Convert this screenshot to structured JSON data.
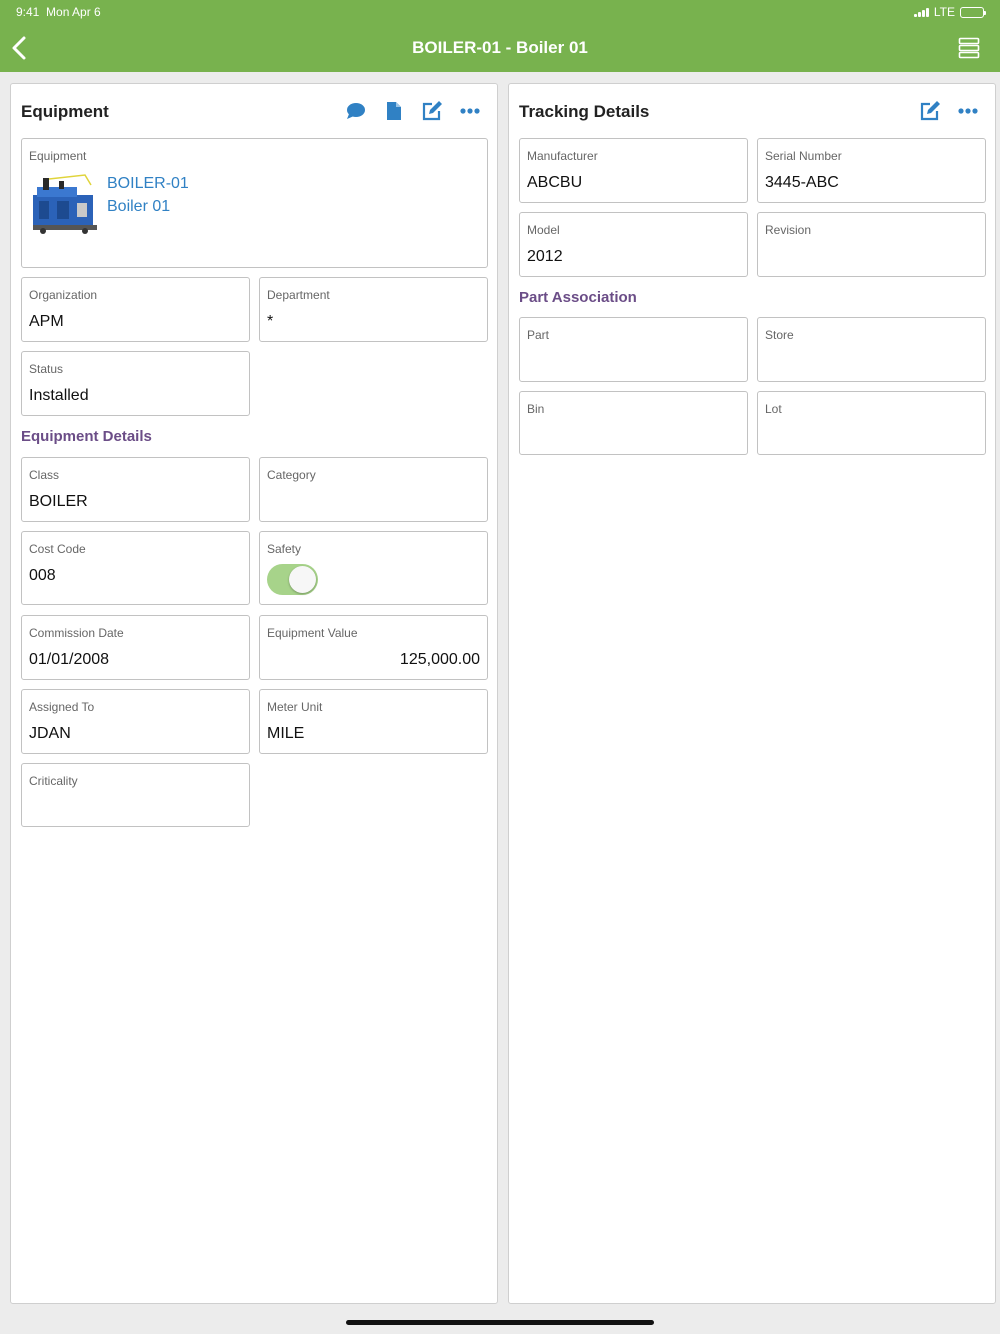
{
  "status_bar": {
    "time": "9:41",
    "date": "Mon Apr 6",
    "network": "LTE"
  },
  "header": {
    "title": "BOILER-01 - Boiler 01",
    "icons": [
      "back-chevron-icon",
      "list-view-icon"
    ]
  },
  "colors": {
    "brand": "#78b24e",
    "link": "#3081c4",
    "section": "#6b4d87",
    "toggle_on": "#a7d38a"
  },
  "equipment_panel": {
    "title": "Equipment",
    "actions": [
      "comment-icon",
      "document-icon",
      "edit-icon",
      "more-icon"
    ],
    "equipment": {
      "label": "Equipment",
      "code": "BOILER-01",
      "description": "Boiler 01",
      "image": "boiler-photo"
    },
    "organization": {
      "label": "Organization",
      "value": "APM"
    },
    "department": {
      "label": "Department",
      "value": "*"
    },
    "status": {
      "label": "Status",
      "value": "Installed"
    },
    "details_heading": "Equipment Details",
    "class": {
      "label": "Class",
      "value": "BOILER"
    },
    "category": {
      "label": "Category",
      "value": ""
    },
    "cost_code": {
      "label": "Cost Code",
      "value": "008"
    },
    "safety": {
      "label": "Safety",
      "on": true
    },
    "commission_date": {
      "label": "Commission Date",
      "value": "01/01/2008"
    },
    "equipment_value": {
      "label": "Equipment Value",
      "value": "125,000.00"
    },
    "assigned_to": {
      "label": "Assigned To",
      "value": "JDAN"
    },
    "meter_unit": {
      "label": "Meter Unit",
      "value": "MILE"
    },
    "criticality": {
      "label": "Criticality",
      "value": ""
    }
  },
  "tracking_panel": {
    "title": "Tracking Details",
    "actions": [
      "edit-icon",
      "more-icon"
    ],
    "manufacturer": {
      "label": "Manufacturer",
      "value": "ABCBU"
    },
    "serial_number": {
      "label": "Serial Number",
      "value": "3445-ABC"
    },
    "model": {
      "label": "Model",
      "value": "2012"
    },
    "revision": {
      "label": "Revision",
      "value": ""
    },
    "part_heading": "Part Association",
    "part": {
      "label": "Part",
      "value": ""
    },
    "store": {
      "label": "Store",
      "value": ""
    },
    "bin": {
      "label": "Bin",
      "value": ""
    },
    "lot": {
      "label": "Lot",
      "value": ""
    }
  }
}
